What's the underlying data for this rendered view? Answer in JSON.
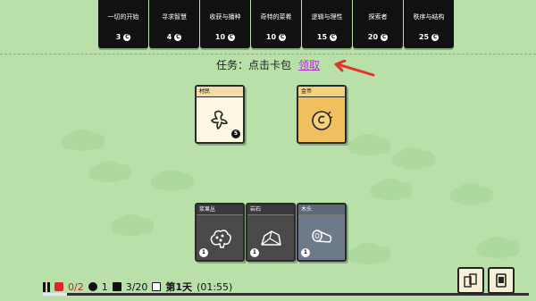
{
  "packs": [
    {
      "name": "一切的开始",
      "cost": "3"
    },
    {
      "name": "寻求智慧",
      "cost": "4"
    },
    {
      "name": "收获与播种",
      "cost": "10"
    },
    {
      "name": "奇特的菜肴",
      "cost": "10"
    },
    {
      "name": "逻辑与理性",
      "cost": "15"
    },
    {
      "name": "探索者",
      "cost": "20"
    },
    {
      "name": "秩序与结构",
      "cost": "25"
    }
  ],
  "quest": {
    "label": "任务：点击卡包",
    "claim": "领取"
  },
  "cards": {
    "villager": {
      "title": "村民",
      "badge": "5"
    },
    "coin": {
      "title": "金币"
    },
    "berry_bush": {
      "title": "浆果丛",
      "badge": "1"
    },
    "rock": {
      "title": "岩石",
      "badge": "1"
    },
    "wood": {
      "title": "木头",
      "badge": "1"
    }
  },
  "status": {
    "food": "0/2",
    "coins": "1",
    "cards": "3/20",
    "day": "第1天",
    "time": "(01:55)"
  },
  "progress_fraction": 0.05,
  "colors": {
    "background": "#b8e0a8",
    "pack": "#111111",
    "accent_claim": "#b030d0",
    "arrow": "#e0352b",
    "food": "#e0252b"
  }
}
